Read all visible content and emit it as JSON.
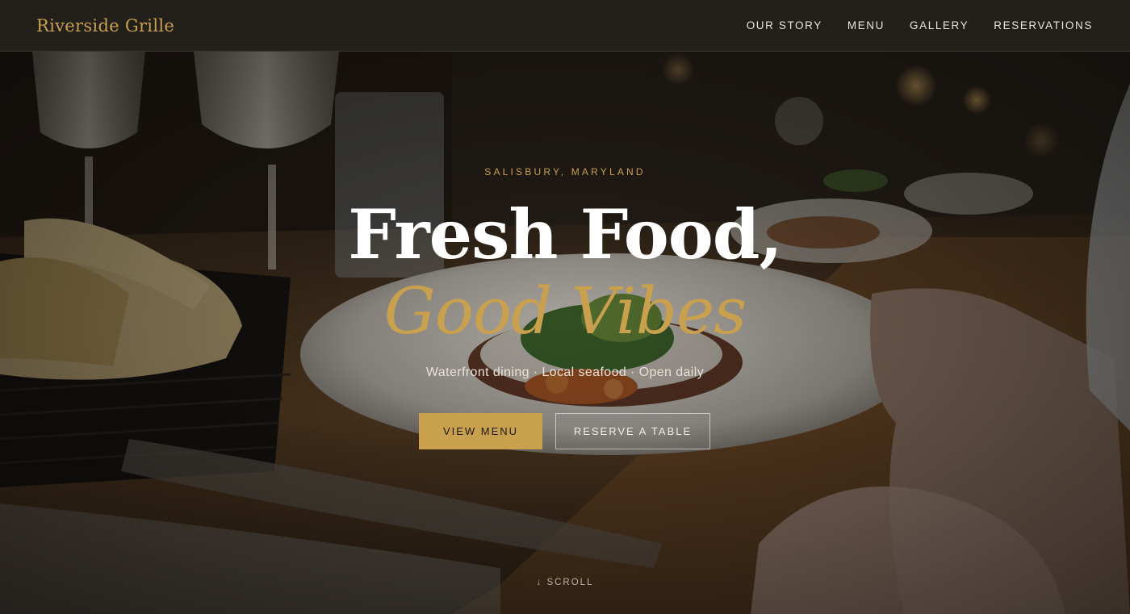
{
  "header": {
    "brand": "Riverside Grille",
    "nav": [
      "OUR STORY",
      "MENU",
      "GALLERY",
      "RESERVATIONS"
    ]
  },
  "hero": {
    "kicker": "SALISBURY, MARYLAND",
    "headline_1": "Fresh Food,",
    "headline_2": "Good Vibes",
    "tagline": "Waterfront dining · Local seafood · Open daily",
    "primary_cta": "VIEW MENU",
    "secondary_cta": "RESERVE A TABLE",
    "scroll_hint": "↓ SCROLL"
  },
  "colors": {
    "accent_gold": "#c9a04d",
    "header_bg": "#231f1b",
    "text_light": "#e9e4dc"
  }
}
